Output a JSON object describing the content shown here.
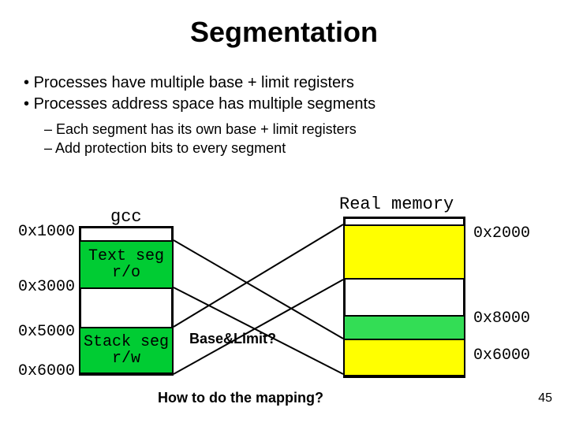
{
  "title": "Segmentation",
  "bullets": {
    "b1": "Processes have multiple base + limit registers",
    "b2": "Processes address space has multiple segments",
    "sub1": "Each segment has its own base + limit registers",
    "sub2": "Add protection bits to every segment"
  },
  "labels": {
    "gcc": "gcc",
    "realmem": "Real memory",
    "baselimit": "Base&Limit?",
    "howto": "How to do the mapping?",
    "pagenum": "45"
  },
  "segments": {
    "text_label1": "Text seg",
    "text_label2": "r/o",
    "stack_label1": "Stack seg",
    "stack_label2": "r/w"
  },
  "addrs": {
    "left": {
      "a1": "0x1000",
      "a2": "0x3000",
      "a3": "0x5000",
      "a4": "0x6000"
    },
    "right": {
      "r1": "0x2000",
      "r2": "0x8000",
      "r3": "0x6000"
    }
  },
  "colors": {
    "green": "#00cc33",
    "yellow": "#ffff00"
  }
}
